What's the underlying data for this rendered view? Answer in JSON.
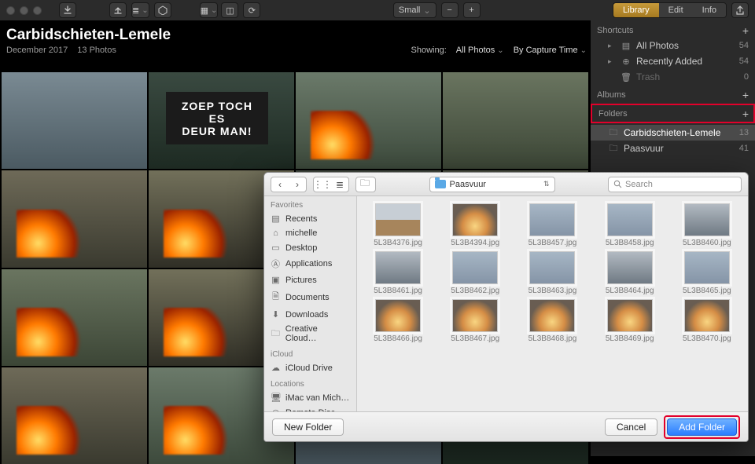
{
  "toolbar": {
    "size_label": "Small",
    "tabs": {
      "library": "Library",
      "edit": "Edit",
      "info": "Info"
    }
  },
  "album": {
    "title": "Carbidschieten-Lemele",
    "date": "December 2017",
    "count_label": "13 Photos",
    "sign_text": "ZOEP TOCH\nES\nDEUR MAN!"
  },
  "filters": {
    "showing_label": "Showing:",
    "showing_value": "All Photos",
    "sort_value": "By Capture Time"
  },
  "sidebar": {
    "shortcuts_label": "Shortcuts",
    "albums_label": "Albums",
    "folders_label": "Folders",
    "items": {
      "all_photos": {
        "label": "All Photos",
        "count": "54"
      },
      "recently_added": {
        "label": "Recently Added",
        "count": "54"
      },
      "trash": {
        "label": "Trash",
        "count": "0"
      }
    },
    "folders": {
      "f1": {
        "label": "Carbidschieten-Lemele",
        "count": "13"
      },
      "f2": {
        "label": "Paasvuur",
        "count": "41"
      }
    }
  },
  "dialog": {
    "path_label": "Paasvuur",
    "search_placeholder": "Search",
    "favorites_label": "Favorites",
    "icloud_label": "iCloud",
    "locations_label": "Locations",
    "fav": {
      "recents": "Recents",
      "michelle": "michelle",
      "desktop": "Desktop",
      "applications": "Applications",
      "pictures": "Pictures",
      "documents": "Documents",
      "downloads": "Downloads",
      "creative": "Creative Cloud…",
      "iclouddrive": "iCloud Drive",
      "imac": "iMac van Mich…",
      "remote": "Remote Disc"
    },
    "files": [
      "5L3B4376.jpg",
      "5L3B4394.jpg",
      "5L3B8457.jpg",
      "5L3B8458.jpg",
      "5L3B8460.jpg",
      "5L3B8461.jpg",
      "5L3B8462.jpg",
      "5L3B8463.jpg",
      "5L3B8464.jpg",
      "5L3B8465.jpg",
      "5L3B8466.jpg",
      "5L3B8467.jpg",
      "5L3B8468.jpg",
      "5L3B8469.jpg",
      "5L3B8470.jpg"
    ],
    "buttons": {
      "new_folder": "New Folder",
      "cancel": "Cancel",
      "add_folder": "Add Folder"
    }
  }
}
